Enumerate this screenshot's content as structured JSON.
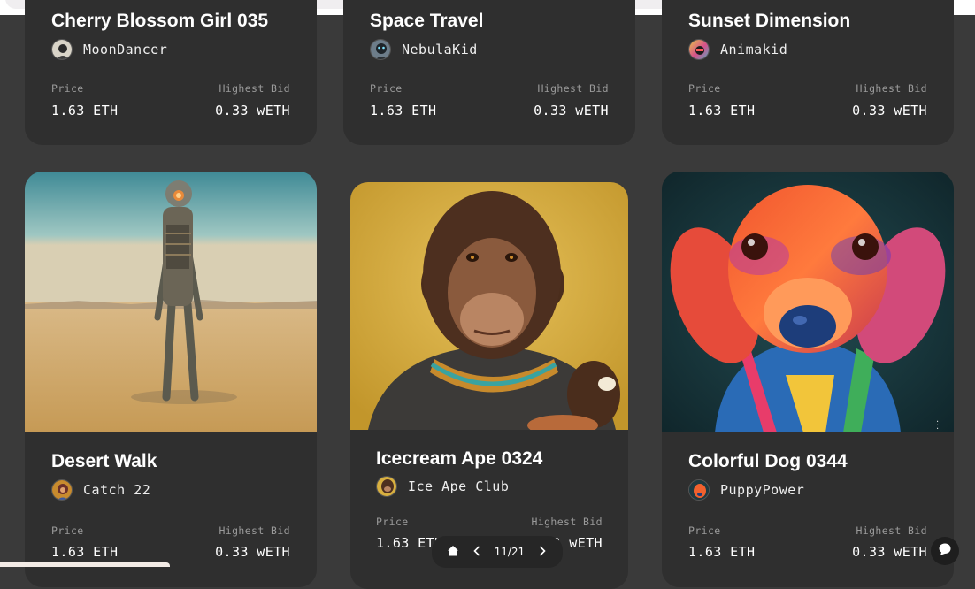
{
  "labels": {
    "price": "Price",
    "highest_bid": "Highest Bid"
  },
  "cards": [
    {
      "title": "Cherry Blossom Girl 035",
      "creator": "MoonDancer",
      "price": "1.63 ETH",
      "bid": "0.33 wETH"
    },
    {
      "title": "Space Travel",
      "creator": "NebulaKid",
      "price": "1.63 ETH",
      "bid": "0.33 wETH"
    },
    {
      "title": "Sunset Dimension",
      "creator": "Animakid",
      "price": "1.63 ETH",
      "bid": "0.33 wETH"
    },
    {
      "title": "Desert Walk",
      "creator": "Catch 22",
      "price": "1.63 ETH",
      "bid": "0.33 wETH"
    },
    {
      "title": "Icecream Ape 0324",
      "creator": "Ice Ape Club",
      "price": "1.63 ETH",
      "bid": "0.33 wETH"
    },
    {
      "title": "Colorful Dog 0344",
      "creator": "PuppyPower",
      "price": "1.63 ETH",
      "bid": "0.33 wETH"
    }
  ],
  "pager": {
    "count": "11/21"
  },
  "icons": {
    "home": "home-icon",
    "prev": "chevron-left-icon",
    "next": "chevron-right-icon",
    "chat": "chat-icon",
    "more": "more-vertical-icon"
  }
}
